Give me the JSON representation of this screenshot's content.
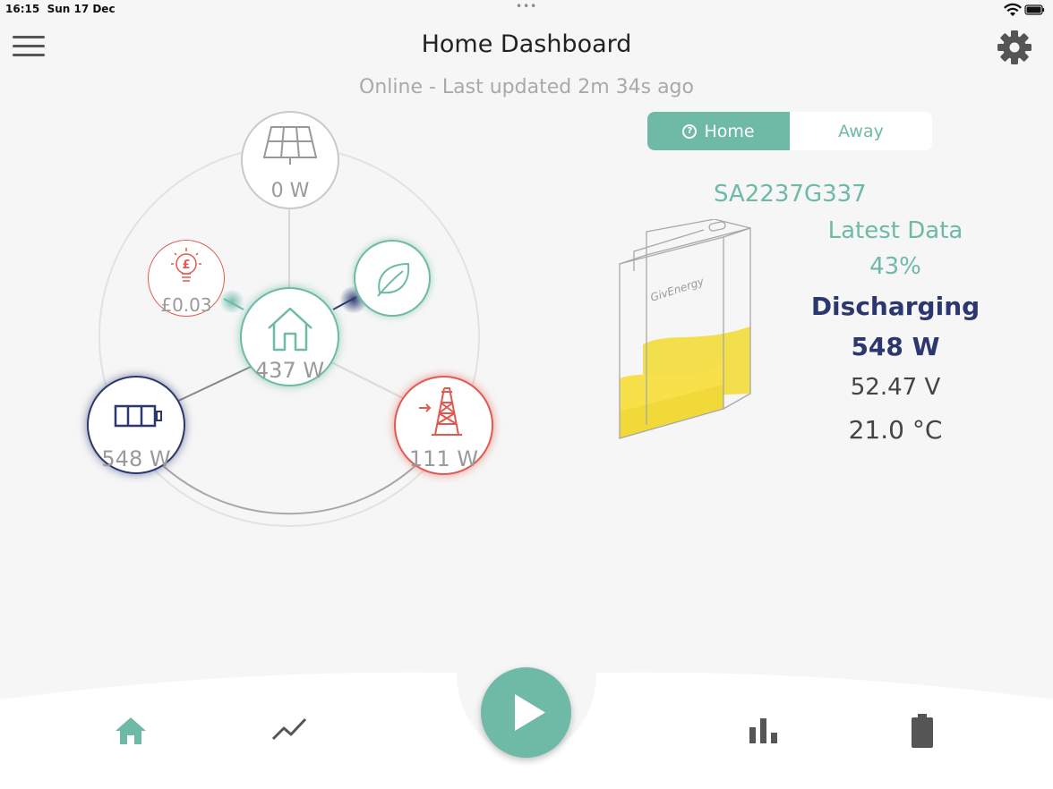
{
  "status_bar": {
    "time": "16:15",
    "date": "Sun 17 Dec"
  },
  "header": {
    "title": "Home Dashboard",
    "subtitle": "Online - Last updated 2m 34s ago"
  },
  "mode_toggle": {
    "options": [
      {
        "label": "Home",
        "selected": true
      },
      {
        "label": "Away",
        "selected": false
      }
    ],
    "help_glyph": "?"
  },
  "flow": {
    "solar": {
      "value": "0 W",
      "icon": "solar-panel-icon"
    },
    "home": {
      "value": "437 W",
      "icon": "house-icon"
    },
    "cost": {
      "value": "£0.03",
      "icon": "lightbulb-pound-icon"
    },
    "eco": {
      "icon": "leaf-icon"
    },
    "battery": {
      "value": "548 W",
      "icon": "battery-icon"
    },
    "grid": {
      "value": "111 W",
      "icon": "pylon-icon"
    }
  },
  "battery_panel": {
    "serial": "SA2237G337",
    "brand_text": "GivEnergy",
    "latest_data_label": "Latest Data",
    "state_of_charge": "43%",
    "state": "Discharging",
    "power": "548 W",
    "voltage": "52.47 V",
    "temperature": "21.0 °C",
    "soc_fraction": 0.43
  },
  "tab_bar": {
    "tabs": [
      {
        "icon": "home-icon",
        "active": true
      },
      {
        "icon": "trend-line-icon",
        "active": false
      },
      {
        "icon": "play-icon",
        "active": false
      },
      {
        "icon": "bar-chart-icon",
        "active": false
      },
      {
        "icon": "battery-tab-icon",
        "active": false
      }
    ]
  },
  "colors": {
    "accent": "#6ebaa7",
    "battery": "#2c3770",
    "grid": "#e05a50",
    "inactive_icon": "#555555",
    "charge_fill": "#f7e04a"
  }
}
